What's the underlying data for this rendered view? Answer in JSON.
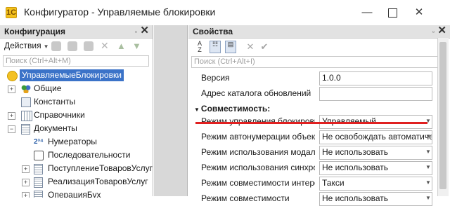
{
  "window": {
    "title": "Конфигуратор - Управляемые блокировки",
    "app_icon": "1С",
    "controls": {
      "minimize": "—",
      "close": "✕"
    }
  },
  "left_panel": {
    "title": "Конфигурация",
    "pin": "▫",
    "close": "✕",
    "actions_label": "Действия",
    "search_placeholder": "Поиск (Ctrl+Alt+M)",
    "tree": [
      {
        "label": "УправляемыеБлокировки",
        "expander": "−",
        "icon": "root-config-icon",
        "selected": true
      },
      {
        "label": "Общие",
        "expander": "+",
        "icon": "common-icon"
      },
      {
        "label": "Константы",
        "expander": "",
        "icon": "constants-icon"
      },
      {
        "label": "Справочники",
        "expander": "+",
        "icon": "catalogs-icon"
      },
      {
        "label": "Документы",
        "expander": "−",
        "icon": "documents-icon"
      },
      {
        "label": "Нумераторы",
        "expander": "",
        "icon": "numerators-icon"
      },
      {
        "label": "Последовательности",
        "expander": "",
        "icon": "sequences-icon"
      },
      {
        "label": "ПоступлениеТоваровУслуг",
        "expander": "+",
        "icon": "document-icon"
      },
      {
        "label": "РеализацияТоваровУслуг",
        "expander": "+",
        "icon": "document-icon"
      },
      {
        "label": "ОперацияБух",
        "expander": "+",
        "icon": "document-icon"
      }
    ]
  },
  "props_panel": {
    "title": "Свойства",
    "pin": "▫",
    "close": "✕",
    "search_placeholder": "Поиск (Ctrl+Alt+I)",
    "rows": [
      {
        "label": "Версия",
        "value": "1.0.0",
        "dropdown": false
      },
      {
        "label": "Адрес каталога обновлений",
        "value": "",
        "dropdown": false
      },
      {
        "label": "Совместимость:",
        "group": true
      },
      {
        "label": "Режим управления блокировкой",
        "value": "Управляемый",
        "dropdown": true
      },
      {
        "label": "Режим автонумерации объектов",
        "value": "Не освобождать автоматически",
        "dropdown": true
      },
      {
        "label": "Режим использования модальности",
        "value": "Не использовать",
        "dropdown": true
      },
      {
        "label": "Режим использования синхронных вызовов",
        "value": "Не использовать",
        "dropdown": true
      },
      {
        "label": "Режим совместимости интерфейса",
        "value": "Такси",
        "dropdown": true
      },
      {
        "label": "Режим совместимости",
        "value": "Не использовать",
        "dropdown": true
      }
    ]
  },
  "colors": {
    "selection": "#3b73c8",
    "highlight_line": "#e02020",
    "panel_header": "#e2e2e2"
  }
}
